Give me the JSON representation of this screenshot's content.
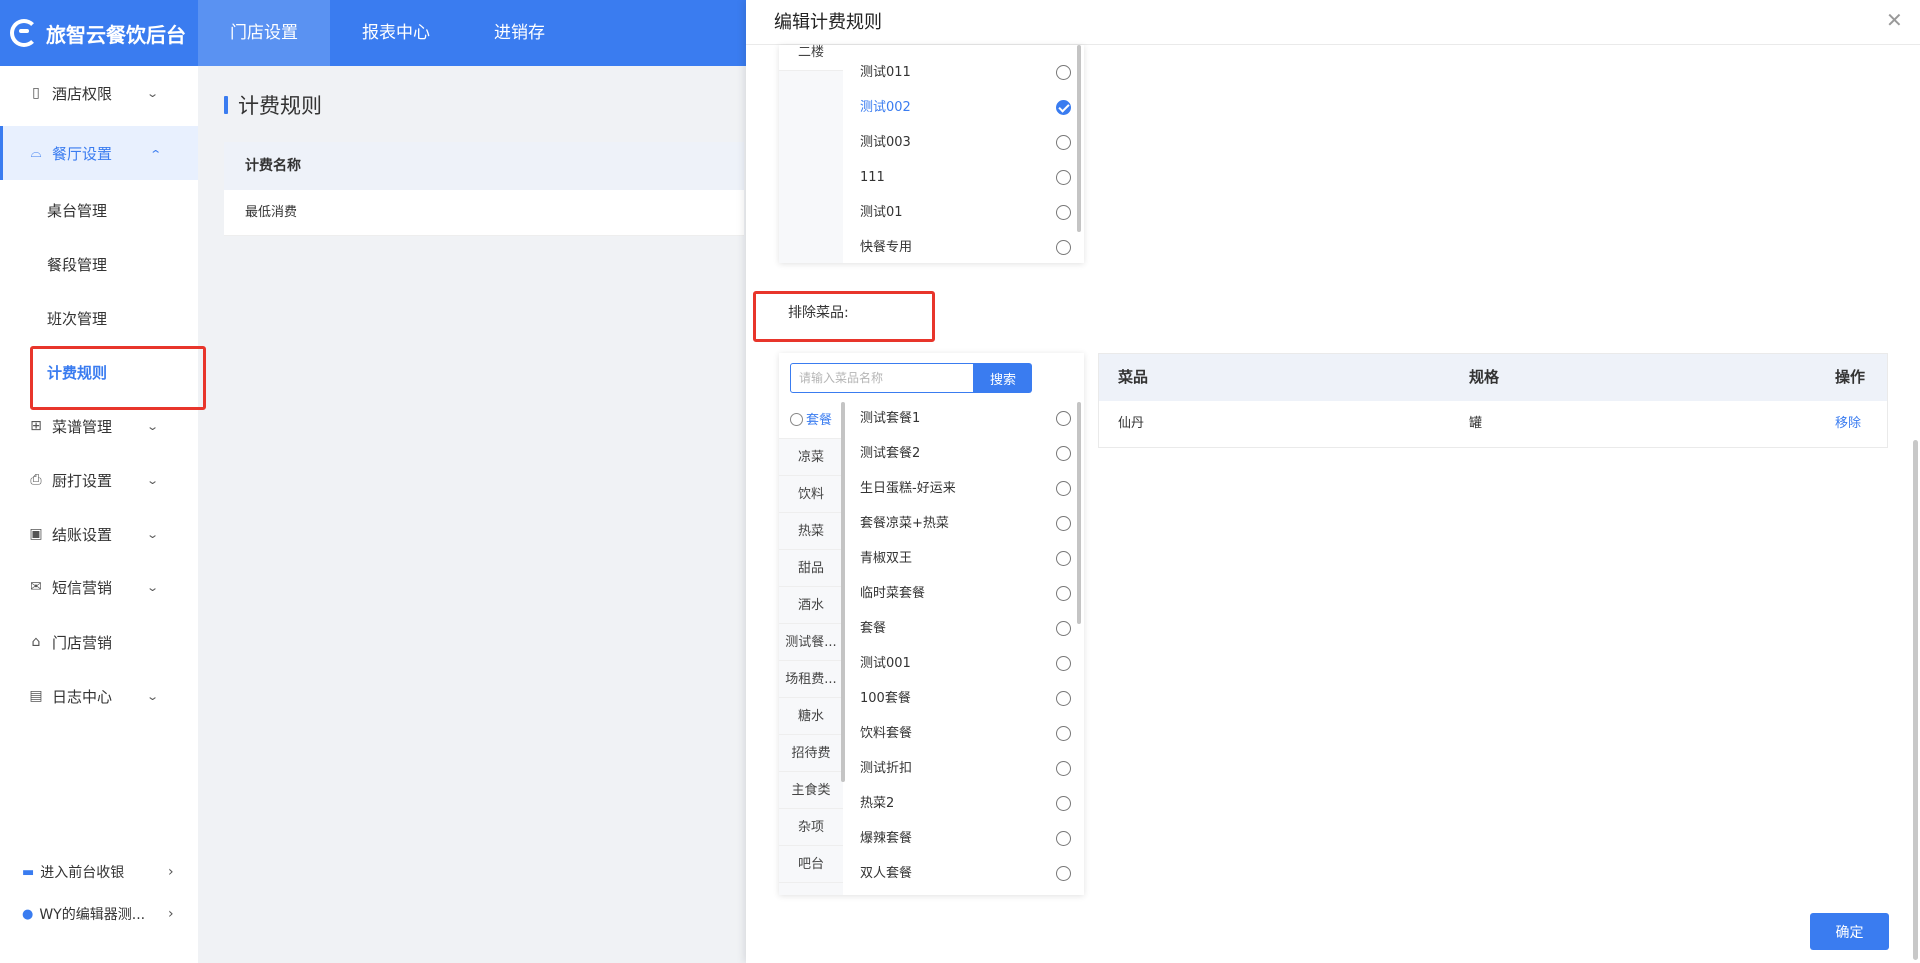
{
  "app": {
    "logo_text": "旅智云餐饮后台"
  },
  "topnav": [
    "门店设置",
    "报表中心",
    "进销存"
  ],
  "sidebar": {
    "hotel_rights": "酒店权限",
    "restaurant_settings": "餐厅设置",
    "subs": [
      "桌台管理",
      "餐段管理",
      "班次管理",
      "计费规则"
    ],
    "menu_mgmt": "菜谱管理",
    "kitchen_print": "厨打设置",
    "checkout": "结账设置",
    "sms": "短信营销",
    "store_marketing": "门店营销",
    "log_center": "日志中心",
    "front_cashier": "进入前台收银",
    "store_name": "WY的编辑器测..."
  },
  "main": {
    "title": "计费规则",
    "table_header": "计费名称",
    "rows": [
      "最低消费"
    ]
  },
  "drawer": {
    "title": "编辑计费规则",
    "close_glyph": "✕",
    "area_tab": "二楼",
    "tables": [
      {
        "label": "测试011",
        "checked": false
      },
      {
        "label": "测试002",
        "checked": true
      },
      {
        "label": "测试003",
        "checked": false
      },
      {
        "label": "111",
        "checked": false
      },
      {
        "label": "测试01",
        "checked": false
      },
      {
        "label": "快餐专用",
        "checked": false
      }
    ],
    "exclude_label": "排除菜品:",
    "search_placeholder": "请输入菜品名称",
    "search_button": "搜索",
    "categories": [
      "套餐",
      "凉菜",
      "饮料",
      "热菜",
      "甜品",
      "酒水",
      "测试餐...",
      "场租费...",
      "糖水",
      "招待费",
      "主食类",
      "杂项",
      "吧台"
    ],
    "dishes": [
      "测试套餐1",
      "测试套餐2",
      "生日蛋糕-好运来",
      "套餐凉菜+热菜",
      "青椒双王",
      "临时菜套餐",
      "套餐",
      "测试001",
      "100套餐",
      "饮料套餐",
      "测试折扣",
      "热菜2",
      "爆辣套餐",
      "双人套餐"
    ],
    "dish_table": {
      "headers": [
        "菜品",
        "规格",
        "操作"
      ],
      "rows": [
        {
          "dish": "仙丹",
          "spec": "罐",
          "action": "移除"
        }
      ]
    },
    "confirm": "确定"
  }
}
